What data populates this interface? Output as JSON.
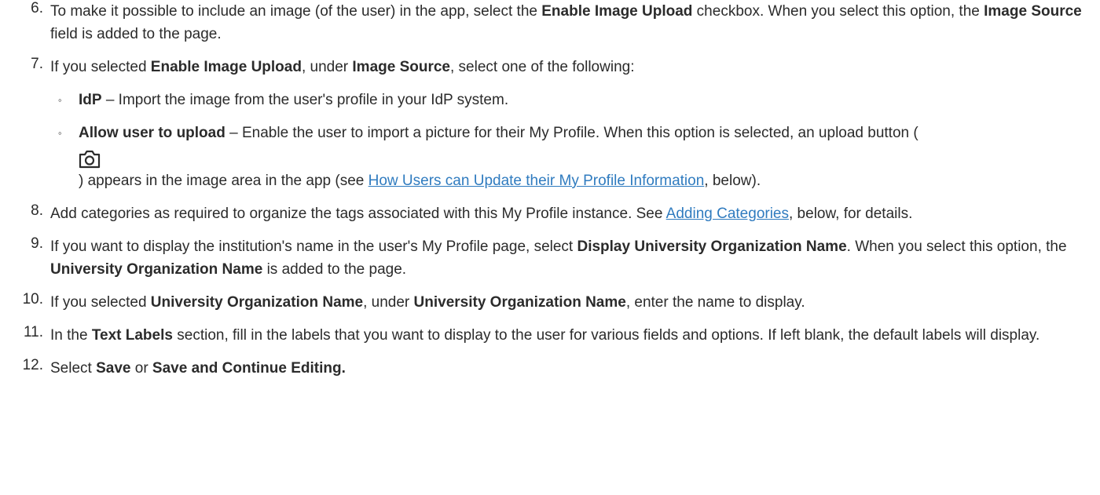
{
  "steps": [
    {
      "number": "6.",
      "segs": [
        "To make it possible to include an image (of the user) in the app, select the ",
        "Enable Image Upload",
        " checkbox. When you select this option, the ",
        "Image Source",
        " field is added to the page."
      ]
    },
    {
      "number": "7.",
      "segs": [
        "If you selected ",
        "Enable Image Upload",
        ", under ",
        "Image Source",
        ", select one of the following:"
      ],
      "options": [
        {
          "bullet": "◦",
          "term": "IdP",
          "text": " – Import the image from the user's profile in your IdP system."
        },
        {
          "bullet": "◦",
          "term": "Allow user to upload",
          "text": " – Enable the user to import a picture for their My Profile. When this option is selected, an upload button (",
          "icon": "camera-icon",
          "after_icon": ") appears in the image area in the app (see ",
          "link": "How Users can Update their My Profile Information",
          "end": ", below)."
        }
      ]
    },
    {
      "number": "8.",
      "segs": [
        "Add categories as required to organize the tags associated with this My Profile instance. See ",
        "Adding Categories",
        ", below, for details."
      ]
    },
    {
      "number": "9.",
      "segs": [
        "If you want to display the institution's name in the user's My Profile page, select ",
        "Display University Organization Name",
        ". When you select this option, the ",
        "University Organization Name",
        " is added to the page."
      ]
    },
    {
      "number": "10.",
      "segs": [
        "If you selected ",
        "University Organization Name",
        ", under ",
        "University Organization Name",
        ", enter the name to display."
      ]
    },
    {
      "number": "11.",
      "segs": [
        "In the ",
        "Text Labels",
        " section, fill in the labels that you want to display to the user for various fields and options. If left blank, the default labels will display."
      ]
    },
    {
      "number": "12.",
      "segs": [
        "Select ",
        "Save",
        " or ",
        "Save and Continue Editing."
      ]
    }
  ],
  "colors": {
    "text": "#2b2b2b",
    "link": "#2f7bbf"
  }
}
